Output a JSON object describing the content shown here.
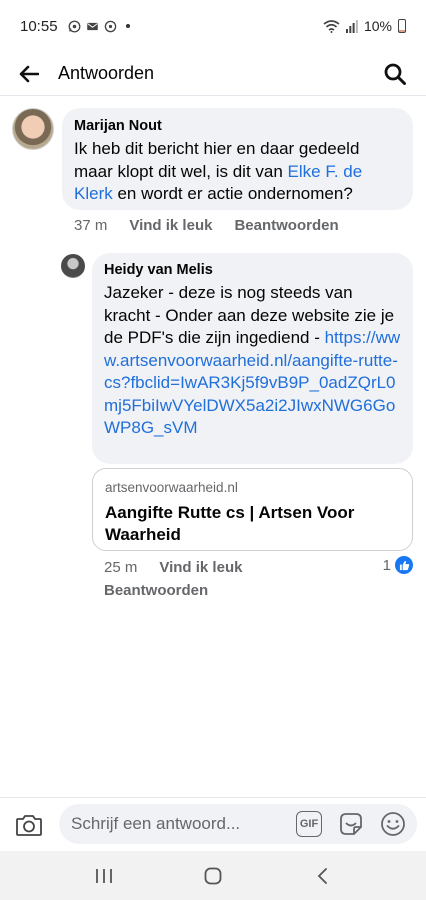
{
  "status_bar": {
    "time": "10:55",
    "battery": "10%"
  },
  "header": {
    "title": "Antwoorden"
  },
  "comment": {
    "author": "Marijan Nout",
    "text_before": "Ik heb dit bericht hier en daar gedeeld maar klopt dit wel,  is dit van ",
    "mention": "Elke F. de Klerk",
    "text_after": " en wordt er actie ondernomen?",
    "time": "37 m",
    "like_label": "Vind ik leuk",
    "reply_label": "Beantwoorden"
  },
  "reply": {
    "author": "Heidy van Melis",
    "text": "Jazeker - deze is nog steeds van kracht - Onder aan deze website zie je de PDF's die zijn ingediend - ",
    "link": "https://www.artsenvoorwaarheid.nl/aangifte-rutte-cs?fbclid=IwAR3Kj5f9vB9P_0adZQrL0mj5FbiIwVYelDWX5a2i2JIwxNWG6GoWP8G_sVM",
    "preview_domain": "artsenvoorwaarheid.nl",
    "preview_title": "Aangifte Rutte cs | Artsen Voor Waarheid",
    "time": "25 m",
    "like_label": "Vind ik leuk",
    "reply_label": "Beantwoorden",
    "reaction_count": "1"
  },
  "composer": {
    "placeholder": "Schrijf een antwoord...",
    "gif_label": "GIF"
  },
  "colors": {
    "link": "#216fdb",
    "bubble": "#f0f2f5",
    "muted": "#65676b",
    "like": "#1877f2"
  }
}
